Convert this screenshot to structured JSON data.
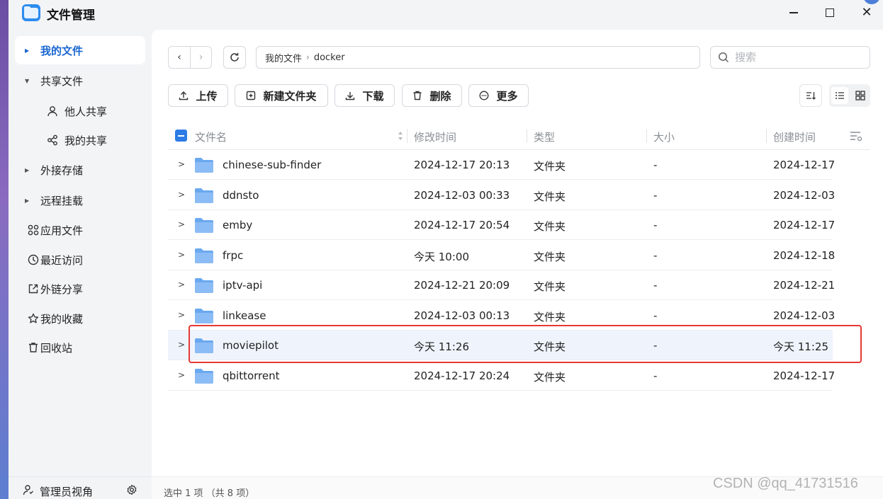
{
  "window": {
    "title": "文件管理",
    "watermark": "CSDN @qq_41731516"
  },
  "sidebar": {
    "items": [
      {
        "label": "我的文件",
        "icon": "caret-right",
        "active": true
      },
      {
        "label": "共享文件",
        "icon": "caret-down"
      },
      {
        "label": "他人共享",
        "icon": "person-icon",
        "sub": true
      },
      {
        "label": "我的共享",
        "icon": "share-icon",
        "sub": true
      },
      {
        "label": "外接存储",
        "icon": "caret-right"
      },
      {
        "label": "远程挂载",
        "icon": "caret-right"
      },
      {
        "label": "应用文件",
        "icon": "apps-grid-icon"
      },
      {
        "label": "最近访问",
        "icon": "clock-icon"
      },
      {
        "label": "外链分享",
        "icon": "external-link-icon"
      },
      {
        "label": "我的收藏",
        "icon": "star-icon"
      },
      {
        "label": "回收站",
        "icon": "trash-icon"
      }
    ],
    "footer": {
      "label": "管理员视角"
    }
  },
  "toolbar": {
    "breadcrumb": [
      "我的文件",
      "docker"
    ],
    "search_placeholder": "搜索",
    "buttons": {
      "upload": "上传",
      "new_folder": "新建文件夹",
      "download": "下载",
      "delete": "删除",
      "more": "更多"
    }
  },
  "table": {
    "columns": [
      "文件名",
      "修改时间",
      "类型",
      "大小",
      "创建时间"
    ],
    "rows": [
      {
        "name": "chinese-sub-finder",
        "mtime": "2024-12-17 20:13",
        "type": "文件夹",
        "size": "-",
        "ctime": "2024-12-17"
      },
      {
        "name": "ddnsto",
        "mtime": "2024-12-03 00:33",
        "type": "文件夹",
        "size": "-",
        "ctime": "2024-12-03"
      },
      {
        "name": "emby",
        "mtime": "2024-12-17 20:54",
        "type": "文件夹",
        "size": "-",
        "ctime": "2024-12-17"
      },
      {
        "name": "frpc",
        "mtime": "今天 10:00",
        "type": "文件夹",
        "size": "-",
        "ctime": "2024-12-18"
      },
      {
        "name": "iptv-api",
        "mtime": "2024-12-21 20:09",
        "type": "文件夹",
        "size": "-",
        "ctime": "2024-12-21"
      },
      {
        "name": "linkease",
        "mtime": "2024-12-03 00:13",
        "type": "文件夹",
        "size": "-",
        "ctime": "2024-12-03"
      },
      {
        "name": "moviepilot",
        "mtime": "今天 11:26",
        "type": "文件夹",
        "size": "-",
        "ctime": "今天 11:25",
        "selected": true
      },
      {
        "name": "qbittorrent",
        "mtime": "2024-12-17 20:24",
        "type": "文件夹",
        "size": "-",
        "ctime": "2024-12-17"
      }
    ]
  },
  "status": {
    "text": "选中 1 项 （共 8 项）"
  },
  "colors": {
    "accent": "#1a66d1",
    "folder": "#6aa8f0",
    "highlight_border": "#e53935",
    "selected_row": "#eff4fc"
  }
}
